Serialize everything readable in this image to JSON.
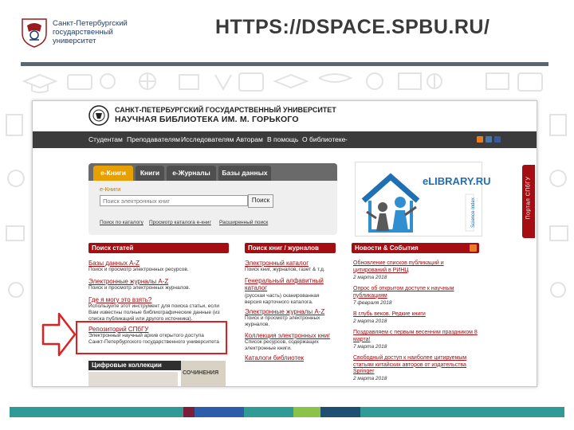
{
  "slide": {
    "logo_lines": [
      "Санкт-Петербургский",
      "государственный",
      "университет"
    ],
    "title": "HTTPS://DSPACE.SPBU.RU/"
  },
  "site": {
    "title_line1": "САНКТ-ПЕТЕРБУРГСКИЙ ГОСУДАРСТВЕННЫЙ УНИВЕРСИТЕТ",
    "title_line2": "НАУЧНАЯ БИБЛИОТЕКА ИМ. М. ГОРЬКОГО",
    "nav": [
      "Студентам",
      "Преподавателям",
      "Исследователям",
      "Авторам",
      "В помощь",
      "О библиотеке"
    ],
    "tabs": [
      "e-Книги",
      "Книги",
      "e-Журналы",
      "Базы данных"
    ],
    "ebooks_label": "e-Книги",
    "search": {
      "placeholder": "Поиск электронных книг",
      "button": "Поиск"
    },
    "tab_links": [
      "Поиск по каталогу",
      "Просмотр каталога e-книг",
      "Расширенный поиск"
    ],
    "elibrary": {
      "logo": "eLIBRARY.RU",
      "vertical_text": "Science Index"
    },
    "portal_tab": "Портал СПбГУ",
    "columns": {
      "articles": {
        "header": "Поиск статей",
        "items": [
          {
            "title": "Базы данных A-Z",
            "desc": "Поиск и просмотр электронных ресурсов."
          },
          {
            "title": "Электронные журналы A-Z",
            "desc": "Поиск и просмотр электронных журналов."
          },
          {
            "title": "Где я могу это взять?",
            "desc": "Используйте этот инструмент для поиска статьи, если Вам известны полные библиографические данные (из списка публикаций или другого источника)."
          },
          {
            "title": "Репозиторий СПбГУ",
            "desc": "Электронный научный архив открытого доступа Санкт-Петербургского государственного университета"
          }
        ]
      },
      "books": {
        "header": "Поиск книг / журналов",
        "items": [
          {
            "title": "Электронный каталог",
            "desc": "Поиск книг, журналов, газет & т.д."
          },
          {
            "title": "Генеральный алфавитный каталог",
            "desc": "(русская часть) сканированная версия карточного каталога."
          },
          {
            "title": "Электронные журналы A-Z",
            "desc": "Поиск и просмотр электронных журналов."
          },
          {
            "title": "Коллекция электронных книг",
            "desc": "Список ресурсов, содержащих электронные книги."
          },
          {
            "title": "Каталоги библиотек",
            "desc": ""
          }
        ]
      },
      "news": {
        "header": "Новости & События",
        "items": [
          {
            "title": "Обновление списков публикаций и цитирований в РИНЦ",
            "date": "2 марта 2018"
          },
          {
            "title": "Опрос об открытом доступе к научным публикациям",
            "date": "7 февраля 2018"
          },
          {
            "title": "В глубь веков. Редкие книги",
            "date": "2 марта 2018"
          },
          {
            "title": "Поздравляем с первым весенним праздником 8 марта!",
            "date": "7 марта 2018"
          },
          {
            "title": "Свободный доступ к наиболее цитируемым статьям китайских авторов от издательства Springer",
            "date": "2 марта 2018"
          }
        ]
      }
    },
    "digital_collections": "Цифровые коллекции",
    "book_cover_text": "СОЧИНЕНИЯ"
  },
  "colors": {
    "nav_bg": "#3b3b3b",
    "accent_red": "#a40e12",
    "tab_active": "#e8a000",
    "highlight": "#e02020",
    "footer_bar": [
      "#2f9a96",
      "#7b1e3b",
      "#2d5da8",
      "#2f9a96",
      "#8bc34a",
      "#1d4f72",
      "#2f9a96"
    ]
  },
  "icons": [
    "university-emblem-icon",
    "rss-icon",
    "vk-icon",
    "facebook-icon",
    "red-arrow-icon"
  ]
}
